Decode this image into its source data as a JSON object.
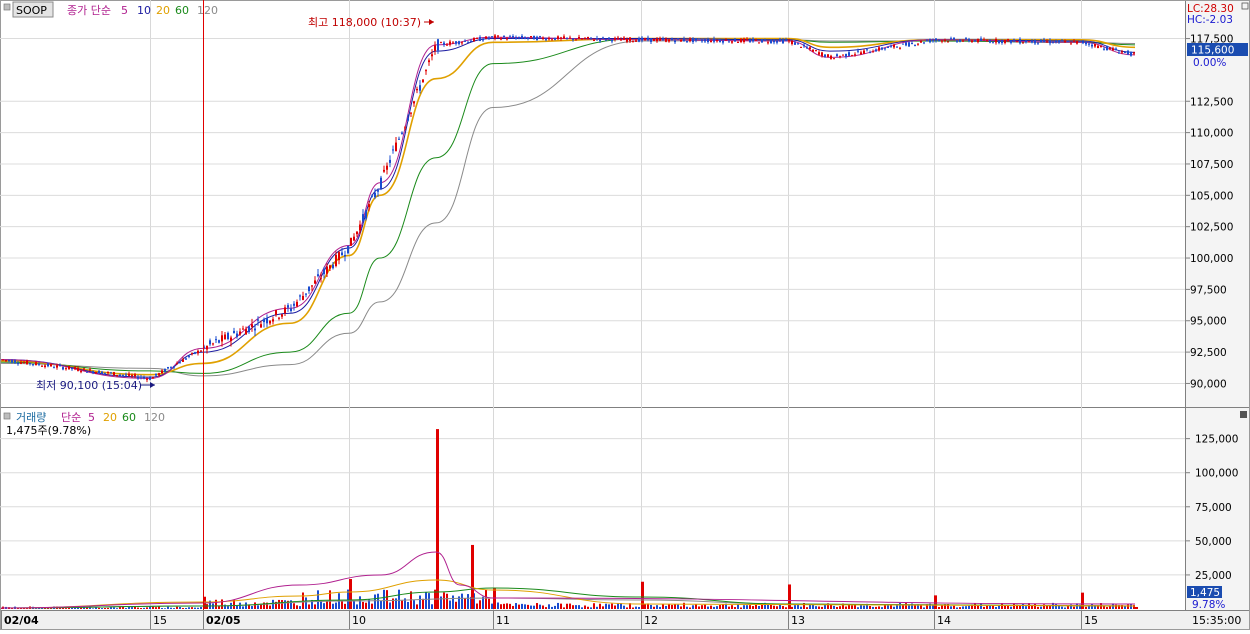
{
  "price_panel": {
    "symbol": "SOOP",
    "legend_label": "종가 단순",
    "ma_periods": [
      "5",
      "10",
      "20",
      "60",
      "120"
    ],
    "lc": "LC:28.30",
    "hc": "HC:-2.03",
    "current_price": "115,600",
    "current_change": "0.00%",
    "high_annotation": "최고 118,000 (10:37)",
    "low_annotation": "최저 90,100 (15:04)",
    "y_ticks": [
      "117,500",
      "112,500",
      "110,000",
      "107,500",
      "105,000",
      "102,500",
      "100,000",
      "97,500",
      "95,000",
      "92,500",
      "90,000"
    ]
  },
  "volume_panel": {
    "legend_label": "거래량",
    "legend_label2": "단순",
    "ma_periods": [
      "5",
      "20",
      "60",
      "120"
    ],
    "current_volume": "1,475주(9.78%)",
    "current_volume_badge": "1,475",
    "current_volume_pct": "9.78%",
    "y_ticks": [
      "125,000",
      "100,000",
      "75,000",
      "50,000",
      "25,000"
    ]
  },
  "x_axis": {
    "labels": [
      "02/04",
      "15",
      "02/05",
      "10",
      "11",
      "12",
      "13",
      "14",
      "15"
    ],
    "time_label": "15:35:00"
  },
  "chart_data": [
    {
      "type": "line",
      "title": "SOOP",
      "ylim": [
        89000,
        118500
      ],
      "x": [
        "02/04 14:00",
        "02/04 15:00",
        "02/05 09:00",
        "02/05 09:30",
        "02/05 10:00",
        "02/05 10:15",
        "02/05 10:37",
        "02/05 11:00",
        "02/05 12:00",
        "02/05 13:00",
        "02/05 13:15",
        "02/05 14:00",
        "02/05 15:00",
        "02/05 15:20"
      ],
      "series": [
        {
          "name": "5",
          "values": [
            91900,
            90400,
            92800,
            96000,
            101000,
            106000,
            117000,
            117600,
            117400,
            117300,
            116000,
            117400,
            117200,
            116200
          ]
        },
        {
          "name": "10",
          "values": [
            91900,
            90500,
            92500,
            95600,
            100800,
            105500,
            116500,
            117500,
            117500,
            117400,
            116500,
            117400,
            117300,
            116400
          ]
        },
        {
          "name": "20",
          "values": [
            91800,
            90700,
            91600,
            94800,
            100200,
            105000,
            114300,
            117200,
            117500,
            117500,
            116800,
            117400,
            117400,
            116800
          ]
        },
        {
          "name": "60",
          "values": [
            91700,
            91000,
            90800,
            92500,
            95600,
            100000,
            108000,
            115500,
            117500,
            117400,
            117200,
            117300,
            117200,
            117000
          ]
        },
        {
          "name": "120",
          "values": [
            91600,
            91200,
            90600,
            91500,
            94000,
            96500,
            102800,
            112000,
            117300,
            117400,
            117300,
            117300,
            117200,
            117100
          ]
        }
      ]
    },
    {
      "type": "bar",
      "title": "거래량",
      "ylim": [
        0,
        135000
      ],
      "categories": [
        "02/04",
        "02/05 09:00",
        "02/05 10:00",
        "02/05 10:37",
        "02/05 10:45",
        "02/05 11:00",
        "02/05 12:00",
        "02/05 13:00",
        "02/05 14:00",
        "02/05 15:00",
        "02/05 15:20"
      ],
      "values": [
        1000,
        9000,
        22000,
        132000,
        47000,
        15000,
        20000,
        18000,
        10000,
        12000,
        1475
      ]
    }
  ]
}
